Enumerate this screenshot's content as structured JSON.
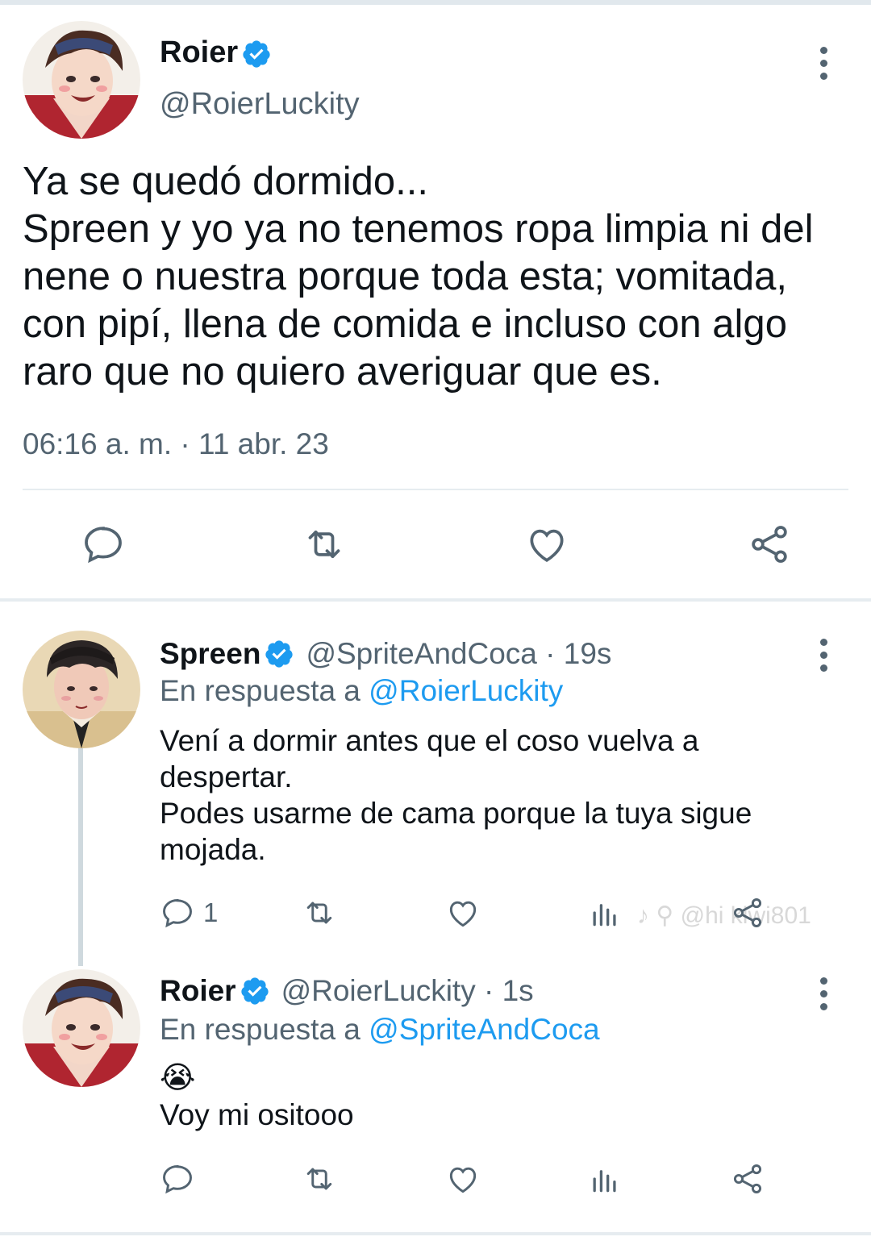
{
  "main_tweet": {
    "author_name": "Roier",
    "author_handle": "@RoierLuckity",
    "text": "Ya se quedó dormido...\nSpreen y yo ya no tenemos ropa limpia ni del nene o nuestra porque toda esta; vomitada, con pipí, llena de comida e incluso con algo raro que no quiero averiguar que es.",
    "timestamp": "06:16 a. m. · 11 abr. 23"
  },
  "replies": [
    {
      "author_name": "Spreen",
      "author_handle": "@SpriteAndCoca · 19s",
      "reply_to_prefix": "En respuesta a ",
      "reply_to_handle": "@RoierLuckity",
      "text": "Vení a dormir antes que el coso vuelva a\ndespertar.\nPodes usarme de cama porque la tuya sigue\nmojada.",
      "reply_count": "1"
    },
    {
      "author_name": "Roier",
      "author_handle": "@RoierLuckity · 1s",
      "reply_to_prefix": "En respuesta a ",
      "reply_to_handle": "@SpriteAndCoca",
      "emoji": "😭",
      "text": "Voy mi ositooo",
      "reply_count": ""
    }
  ],
  "watermark": "♪ ⚲ @hi kiwi801",
  "colors": {
    "text": "#0f1419",
    "secondary": "#536471",
    "link": "#1d9bf0",
    "verified": "#1d9bf0",
    "divider": "#e6ecf0"
  },
  "icons": [
    "reply-icon",
    "retweet-icon",
    "like-icon",
    "share-icon",
    "views-icon",
    "more-icon",
    "verified-icon"
  ]
}
